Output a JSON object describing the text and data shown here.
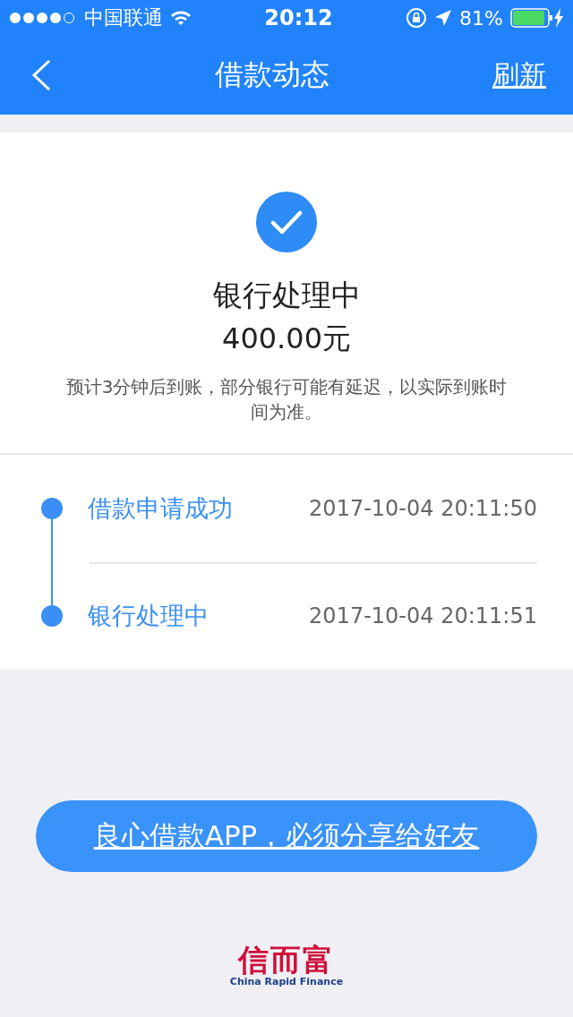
{
  "status_bar": {
    "carrier": "中国联通",
    "time": "20:12",
    "battery": "81%"
  },
  "nav": {
    "title": "借款动态",
    "action": "刷新"
  },
  "status": {
    "title": "银行处理中",
    "amount": "400.00元",
    "note": "预计3分钟后到账，部分银行可能有延迟，以实际到账时间为准。"
  },
  "timeline": [
    {
      "label": "借款申请成功",
      "time": "2017-10-04 20:11:50"
    },
    {
      "label": "银行处理中",
      "time": "2017-10-04 20:11:51"
    }
  ],
  "share_button": "良心借款APP，必须分享给好友",
  "logo": {
    "name": "信而富",
    "tagline": "China Rapid Finance"
  }
}
